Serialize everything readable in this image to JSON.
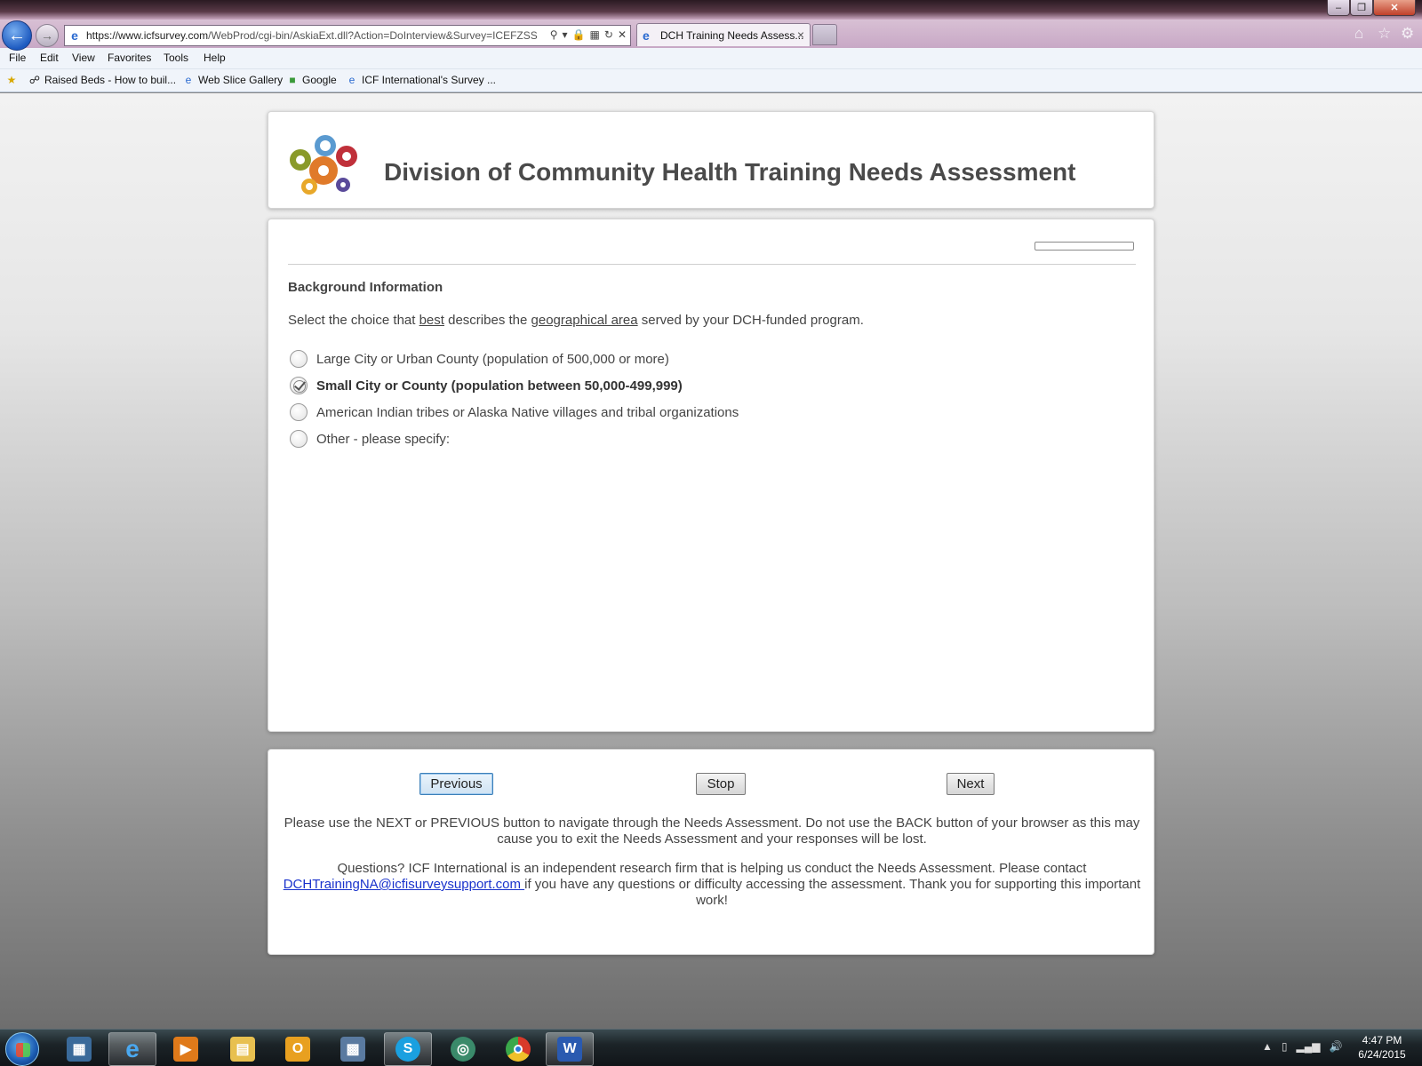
{
  "browser": {
    "url_host": "https://www.icfsurvey.com",
    "url_path": "/WebProd/cgi-bin/AskiaExt.dll?Action=DoInterview&Survey=ICEFZSS",
    "tab_title": "DCH Training Needs Assess...",
    "menu": [
      "File",
      "Edit",
      "View",
      "Favorites",
      "Tools",
      "Help"
    ],
    "favorites": [
      "Raised Beds - How to buil...",
      "Web Slice Gallery",
      "Google",
      "ICF International's Survey ..."
    ]
  },
  "header": {
    "title": "Division of Community Health Training Needs Assessment"
  },
  "survey": {
    "progress_percent": 0,
    "section_title": "Background Information",
    "question_parts": {
      "p1": "Select the choice that ",
      "u1": "best",
      "p2": " describes the ",
      "u2": "geographical area",
      "p3": " served by your DCH-funded program."
    },
    "options": [
      {
        "label": "Large City or Urban County (population of 500,000 or more)",
        "selected": false
      },
      {
        "label": "Small City or County (population between 50,000-499,999)",
        "selected": true
      },
      {
        "label": "American Indian tribes or Alaska Native villages and tribal organizations",
        "selected": false
      },
      {
        "label": "Other - please specify:",
        "selected": false
      }
    ]
  },
  "navigation": {
    "previous_label": "Previous",
    "stop_label": "Stop",
    "next_label": "Next",
    "help_text": "Please use the NEXT or PREVIOUS button to navigate through the Needs Assessment. Do not use the BACK button of your browser as this may cause you to exit the Needs Assessment and your responses will be lost.",
    "contact_pre": "Questions? ICF International is an independent research firm that is helping us conduct the Needs Assessment. Please contact ",
    "contact_email": "DCHTrainingNA@icfisurveysupport.com ",
    "contact_post": "if you have any questions or difficulty accessing the assessment. Thank you for supporting this important work!"
  },
  "taskbar": {
    "time": "4:47 PM",
    "date": "6/24/2015"
  },
  "colors": {
    "link": "#1a33cc",
    "title_gray": "#4a4a4a",
    "taskbar": "#1c2428"
  }
}
